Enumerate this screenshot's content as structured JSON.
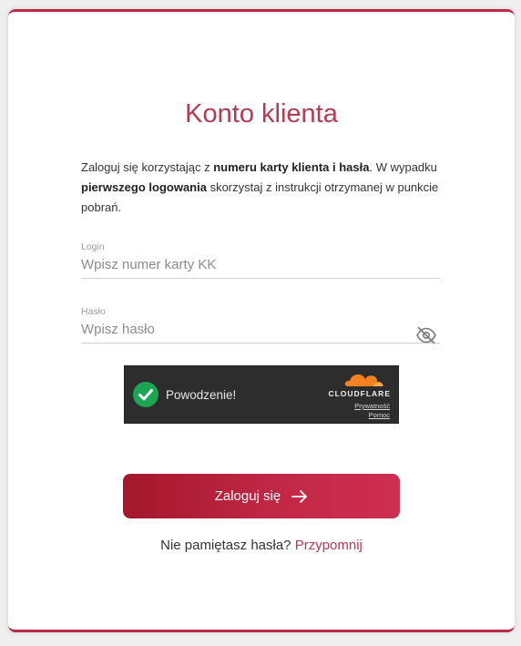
{
  "title": "Konto klienta",
  "intro": {
    "part1": "Zaloguj się korzystając z ",
    "bold1": "numeru karty klienta i hasła",
    "part2": ". W wypadku ",
    "bold2": "pierwszego logowania",
    "part3": " skorzystaj z instrukcji otrzymanej w punkcie pobrań."
  },
  "login": {
    "label": "Login",
    "placeholder": "Wpisz numer karty KK",
    "value": ""
  },
  "password": {
    "label": "Hasło",
    "placeholder": "Wpisz hasło",
    "value": "",
    "toggle_icon": "eye-off-icon"
  },
  "captcha": {
    "status": "Powodzenie!",
    "brand": "CLOUDFLARE",
    "privacy": "Prywatność",
    "help": "Pomoc",
    "check_color": "#1aa653",
    "logo_color": "#f48120"
  },
  "submit": {
    "label": "Zaloguj się",
    "icon": "arrow-right-icon"
  },
  "reminder": {
    "text": "Nie pamiętasz hasła? ",
    "link": "Przypomnij"
  },
  "colors": {
    "accent": "#b43a52",
    "button_start": "#a4172c",
    "button_end": "#cf2e50"
  }
}
